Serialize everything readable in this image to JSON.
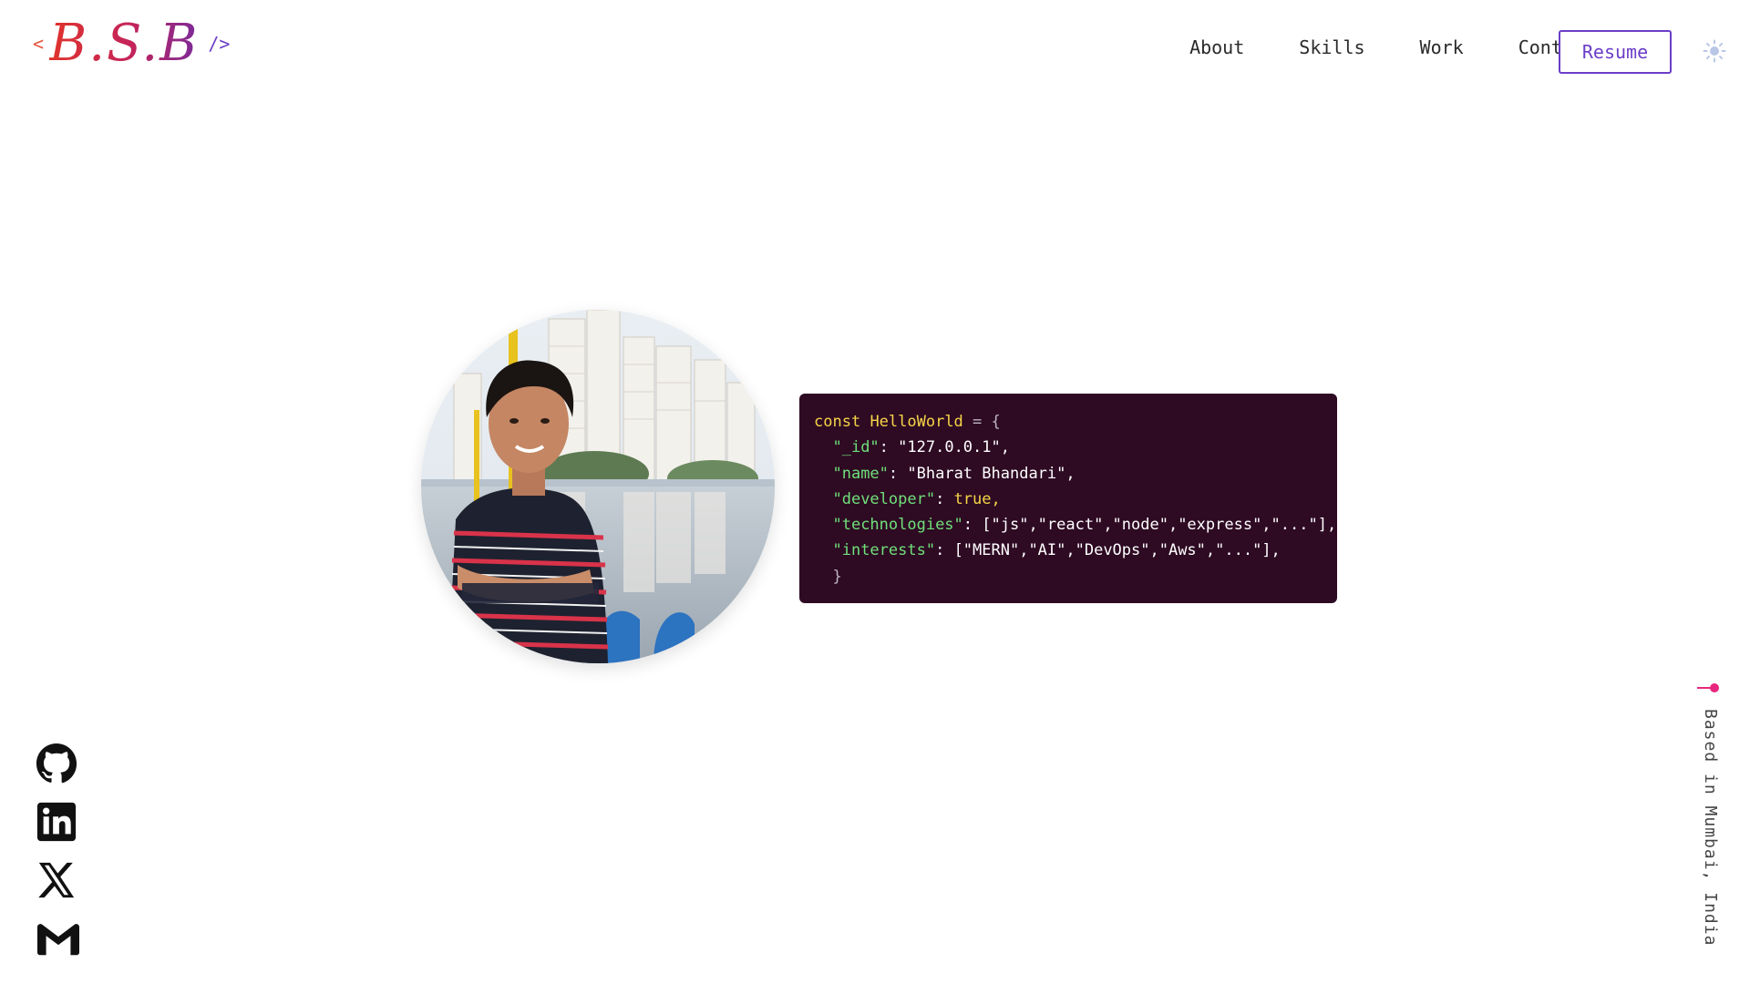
{
  "logo": {
    "open_bracket": "<",
    "mark": "B.S.B",
    "close_bracket": "/>"
  },
  "nav": {
    "items": [
      "About",
      "Skills",
      "Work",
      "Contact"
    ],
    "resume_label": "Resume"
  },
  "theme_toggle_icon": "sun-icon",
  "code": {
    "declaration_keyword": "const",
    "declaration_name": "HelloWorld",
    "open_brace": "= {",
    "lines": [
      {
        "key": "\"_id\"",
        "value": "\"127.0.0.1\","
      },
      {
        "key": "\"name\"",
        "value": "\"Bharat Bhandari\","
      },
      {
        "key": "\"developer\"",
        "value": "true,"
      },
      {
        "key": "\"technologies\"",
        "value": "[\"js\",\"react\",\"node\",\"express\",\"...\"],"
      },
      {
        "key": "\"interests\"",
        "value": "[\"MERN\",\"AI\",\"DevOps\",\"Aws\",\"...\"],"
      }
    ],
    "close_brace": "}"
  },
  "socials": [
    {
      "name": "github",
      "icon": "github-icon"
    },
    {
      "name": "linkedin",
      "icon": "linkedin-icon"
    },
    {
      "name": "x",
      "icon": "x-icon"
    },
    {
      "name": "gmail",
      "icon": "gmail-icon"
    }
  ],
  "location": {
    "text": "Based in Mumbai, India"
  },
  "colors": {
    "accent": "#6b3ec7",
    "code_bg": "#2e0a23",
    "code_key": "#6fe07a",
    "code_keyword": "#f5d547",
    "location_dot": "#e8267e"
  }
}
